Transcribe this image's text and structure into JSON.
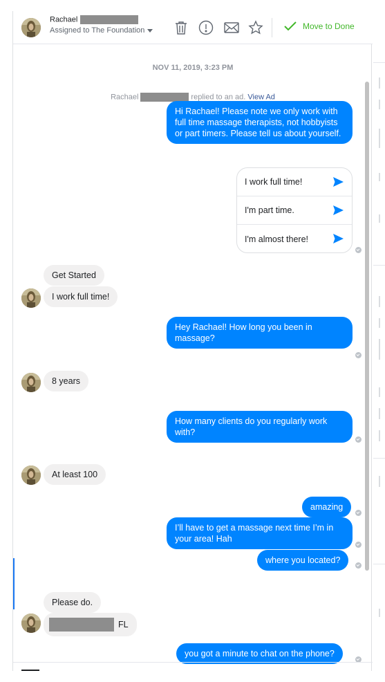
{
  "header": {
    "contact_name": "Rachael",
    "assigned_to": "Assigned to The Foundation",
    "move_to_done": "Move to Done",
    "icons": [
      "trash-icon",
      "spam-icon",
      "mail-icon",
      "star-icon",
      "check-icon"
    ]
  },
  "thread": {
    "timestamp": "NOV 11, 2019, 3:23 PM",
    "ad_note": {
      "name": "Rachael",
      "action": "replied to an ad.",
      "link": "View Ad"
    },
    "messages": [
      {
        "from": "page",
        "text": "Hi Rachael! Please note we only work with full time massage therapists, not hobbyists or part timers. Please tell us about yourself."
      },
      {
        "from": "contact",
        "text": "Get Started"
      },
      {
        "from": "contact",
        "text": "I work full time!"
      },
      {
        "from": "page",
        "text": "Hey Rachael! How long you been in massage?"
      },
      {
        "from": "contact",
        "text": "8 years"
      },
      {
        "from": "page",
        "text": "How many clients do you regularly work with?"
      },
      {
        "from": "contact",
        "text": "At least 100"
      },
      {
        "from": "page",
        "text": "amazing"
      },
      {
        "from": "page",
        "text": "I’ll have to get a massage next time I’m in your area! Hah"
      },
      {
        "from": "page",
        "text": "where you located?"
      },
      {
        "from": "contact",
        "text": "Please do."
      },
      {
        "from": "contact",
        "text": "FL"
      },
      {
        "from": "page",
        "text": "you got a minute to chat on the phone?"
      }
    ],
    "quick_replies": [
      "I work full time!",
      "I'm part time.",
      "I'm almost there!"
    ]
  },
  "colors": {
    "outgoing_bubble": "#0084ff",
    "incoming_bubble": "#f1f0f0",
    "done_green": "#42b72a",
    "link_blue": "#385898"
  }
}
